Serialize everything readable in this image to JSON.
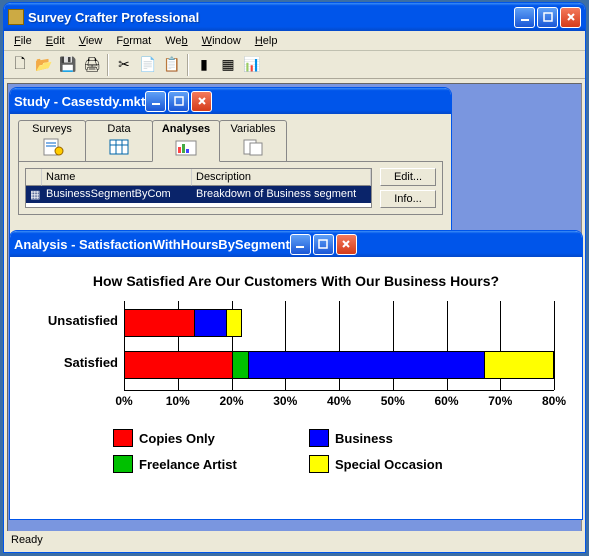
{
  "app": {
    "title": "Survey Crafter Professional"
  },
  "menu": {
    "file": "File",
    "edit": "Edit",
    "view": "View",
    "format": "Format",
    "web": "Web",
    "window": "Window",
    "help": "Help"
  },
  "toolbar": {
    "new": "new",
    "open": "open",
    "save": "save",
    "print": "print",
    "cut": "cut",
    "copy": "copy",
    "paste": "paste",
    "analysis": "analysis",
    "table": "table",
    "chart": "chart"
  },
  "status": {
    "text": "Ready"
  },
  "study_window": {
    "title": "Study - Casestdy.mkt",
    "tabs": {
      "surveys": "Surveys",
      "data": "Data",
      "analyses": "Analyses",
      "variables": "Variables"
    },
    "list": {
      "col_name": "Name",
      "col_desc": "Description",
      "row0_name": "BusinessSegmentByCom",
      "row0_desc": "Breakdown of Business segment"
    },
    "buttons": {
      "edit": "Edit...",
      "info": "Info..."
    }
  },
  "analysis_window": {
    "title": "Analysis - SatisfactionWithHoursBySegment"
  },
  "chart_data": {
    "type": "bar",
    "orientation": "horizontal-stacked",
    "title": "How Satisfied Are Our Customers With Our Business Hours?",
    "xlabel": "",
    "ylabel": "",
    "xlim": [
      0,
      80
    ],
    "xticks": [
      "0%",
      "10%",
      "20%",
      "30%",
      "40%",
      "50%",
      "60%",
      "70%",
      "80%"
    ],
    "categories": [
      "Unsatisfied",
      "Satisfied"
    ],
    "series": [
      {
        "name": "Copies Only",
        "color": "#ff0000",
        "values": [
          13,
          20
        ]
      },
      {
        "name": "Freelance Artist",
        "color": "#00c000",
        "values": [
          0,
          3
        ]
      },
      {
        "name": "Business",
        "color": "#0000ff",
        "values": [
          6,
          44
        ]
      },
      {
        "name": "Special Occasion",
        "color": "#ffff00",
        "values": [
          3,
          13
        ]
      }
    ],
    "legend": [
      {
        "name": "Copies Only",
        "color": "#ff0000"
      },
      {
        "name": "Business",
        "color": "#0000ff"
      },
      {
        "name": "Freelance Artist",
        "color": "#00c000"
      },
      {
        "name": "Special Occasion",
        "color": "#ffff00"
      }
    ]
  }
}
